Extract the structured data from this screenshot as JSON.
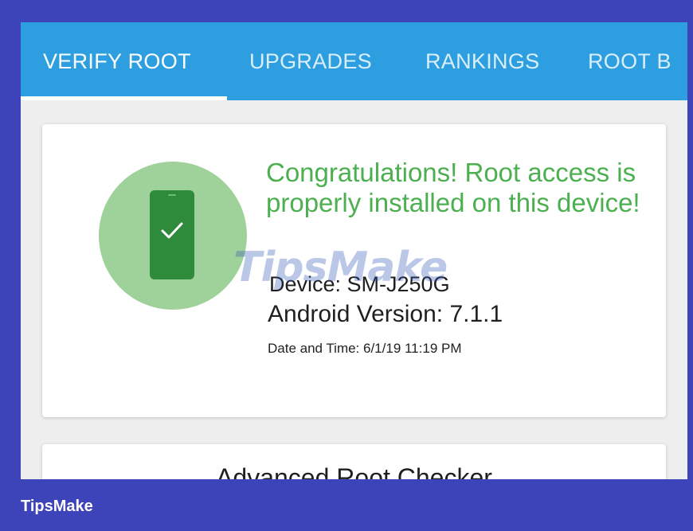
{
  "tabs": [
    {
      "label": "VERIFY ROOT",
      "selected": true
    },
    {
      "label": "UPGRADES",
      "selected": false
    },
    {
      "label": "RANKINGS",
      "selected": false
    },
    {
      "label": "ROOT B",
      "selected": false
    }
  ],
  "status_card": {
    "title": "Congratulations! Root access is properly installed on this device!",
    "device": "Device: SM-J250G",
    "android_version": "Android Version: 7.1.1",
    "date_time": "Date and Time: 6/1/19 11:19 PM",
    "icon": "phone-check-icon"
  },
  "advanced_card": {
    "title": "Advanced Root Checker"
  },
  "watermark": "TipsMake",
  "footer": {
    "brand": "TipsMake"
  },
  "colors": {
    "frame": "#3d43b8",
    "tabbar": "#2d9fe0",
    "success_text": "#4caf50",
    "circle": "#9fd19a",
    "phone": "#2e8b3c"
  }
}
